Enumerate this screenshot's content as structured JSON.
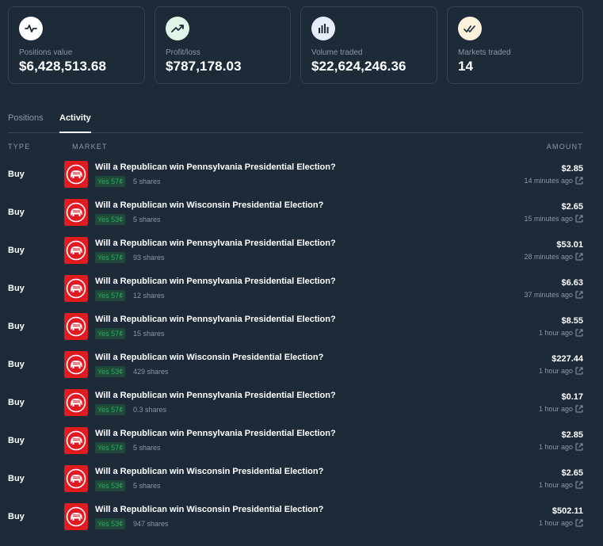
{
  "stats": [
    {
      "label": "Positions value",
      "value": "$6,428,513.68",
      "icon": "activity-pulse-icon",
      "bg": "#ffffff",
      "fg": "#1d2b39"
    },
    {
      "label": "Profit/loss",
      "value": "$787,178.03",
      "icon": "trending-up-icon",
      "bg": "#e2f5e9",
      "fg": "#1d2b39"
    },
    {
      "label": "Volume traded",
      "value": "$22,624,246.36",
      "icon": "bar-chart-icon",
      "bg": "#e6ecf8",
      "fg": "#1d2b39"
    },
    {
      "label": "Markets traded",
      "value": "14",
      "icon": "double-check-icon",
      "bg": "#fdf1db",
      "fg": "#1d2b39"
    }
  ],
  "tabs": [
    {
      "label": "Positions",
      "active": false
    },
    {
      "label": "Activity",
      "active": true
    }
  ],
  "table": {
    "headers": {
      "type": "TYPE",
      "market": "MARKET",
      "amount": "AMOUNT"
    },
    "rows": [
      {
        "type": "Buy",
        "title": "Will a Republican win Pennsylvania Presidential Election?",
        "outcome": "Yes 57¢",
        "shares": "5 shares",
        "amount": "$2.85",
        "time": "14 minutes ago"
      },
      {
        "type": "Buy",
        "title": "Will a Republican win Wisconsin Presidential Election?",
        "outcome": "Yes 53¢",
        "shares": "5 shares",
        "amount": "$2.65",
        "time": "15 minutes ago"
      },
      {
        "type": "Buy",
        "title": "Will a Republican win Pennsylvania Presidential Election?",
        "outcome": "Yes 57¢",
        "shares": "93 shares",
        "amount": "$53.01",
        "time": "28 minutes ago"
      },
      {
        "type": "Buy",
        "title": "Will a Republican win Pennsylvania Presidential Election?",
        "outcome": "Yes 57¢",
        "shares": "12 shares",
        "amount": "$6.63",
        "time": "37 minutes ago"
      },
      {
        "type": "Buy",
        "title": "Will a Republican win Pennsylvania Presidential Election?",
        "outcome": "Yes 57¢",
        "shares": "15 shares",
        "amount": "$8.55",
        "time": "1 hour ago"
      },
      {
        "type": "Buy",
        "title": "Will a Republican win Wisconsin Presidential Election?",
        "outcome": "Yes 53¢",
        "shares": "429 shares",
        "amount": "$227.44",
        "time": "1 hour ago"
      },
      {
        "type": "Buy",
        "title": "Will a Republican win Pennsylvania Presidential Election?",
        "outcome": "Yes 57¢",
        "shares": "0.3 shares",
        "amount": "$0.17",
        "time": "1 hour ago"
      },
      {
        "type": "Buy",
        "title": "Will a Republican win Pennsylvania Presidential Election?",
        "outcome": "Yes 57¢",
        "shares": "5 shares",
        "amount": "$2.85",
        "time": "1 hour ago"
      },
      {
        "type": "Buy",
        "title": "Will a Republican win Wisconsin Presidential Election?",
        "outcome": "Yes 53¢",
        "shares": "5 shares",
        "amount": "$2.65",
        "time": "1 hour ago"
      },
      {
        "type": "Buy",
        "title": "Will a Republican win Wisconsin Presidential Election?",
        "outcome": "Yes 53¢",
        "shares": "947 shares",
        "amount": "$502.11",
        "time": "1 hour ago"
      }
    ]
  },
  "colors": {
    "background": "#1d2b39",
    "border": "#344452",
    "muted_text": "#8a98a6",
    "yes_green": "#27ae60",
    "yes_pill_bg": "#1f4a3a",
    "republican_red": "#e21b23"
  }
}
